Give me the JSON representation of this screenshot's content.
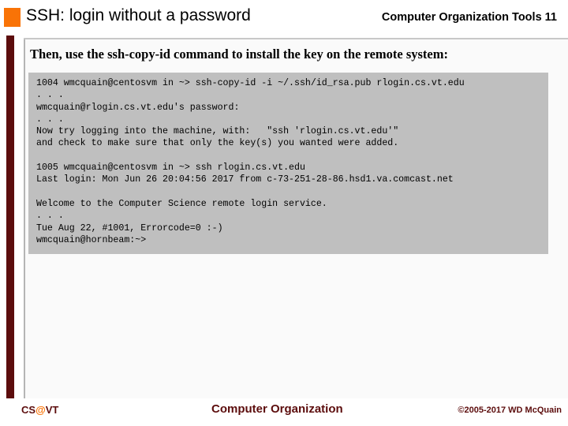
{
  "header": {
    "title": "SSH: login without a password",
    "course_label": "Computer Organization Tools 11",
    "accent_color": "#f97306"
  },
  "body": {
    "intro_text": "Then, use the ssh-copy-id command to install the key on the remote system:"
  },
  "terminal": {
    "background_color": "#bfbfbf",
    "lines": [
      "1004 wmcquain@centosvm in ~> ssh-copy-id -i ~/.ssh/id_rsa.pub rlogin.cs.vt.edu",
      ". . .",
      "wmcquain@rlogin.cs.vt.edu's password:",
      ". . .",
      "Now try logging into the machine, with:   \"ssh 'rlogin.cs.vt.edu'\"",
      "and check to make sure that only the key(s) you wanted were added.",
      "",
      "1005 wmcquain@centosvm in ~> ssh rlogin.cs.vt.edu",
      "Last login: Mon Jun 26 20:04:56 2017 from c-73-251-28-86.hsd1.va.comcast.net",
      "",
      "Welcome to the Computer Science remote login service.",
      ". . .",
      "Tue Aug 22, #1001, Errorcode=0 :-)",
      "wmcquain@hornbeam:~>"
    ]
  },
  "footer": {
    "brand_cs": "CS",
    "brand_at": "@",
    "brand_vt": "VT",
    "center_label": "Computer Organization",
    "copyright": "©2005-2017 WD McQuain",
    "brand_color": "#5c0d0d"
  }
}
